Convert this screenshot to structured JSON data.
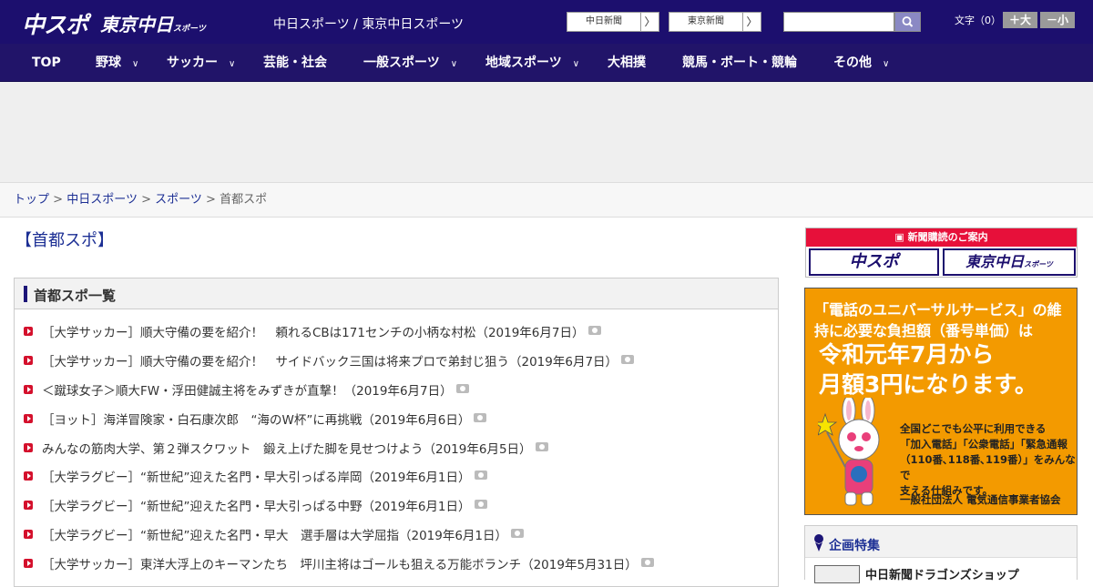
{
  "header": {
    "logo_chuspo": "中スポ",
    "logo_tokyochunichi": "東京中日",
    "logo_tokyochunichi_sub": "スポーツ",
    "site_title": "中日スポーツ / 東京中日スポーツ",
    "link_chunichi": "中日新聞",
    "link_tokyo": "東京新聞",
    "link_arrow": "〉",
    "search_placeholder": "",
    "font_label": "文字（0）",
    "font_larger": "＋大",
    "font_smaller": "－小"
  },
  "nav": {
    "items": [
      {
        "label": "TOP",
        "chevron": false
      },
      {
        "label": "野球",
        "chevron": true
      },
      {
        "label": "サッカー",
        "chevron": true
      },
      {
        "label": "芸能・社会",
        "chevron": false
      },
      {
        "label": "一般スポーツ",
        "chevron": true
      },
      {
        "label": "地域スポーツ",
        "chevron": true
      },
      {
        "label": "大相撲",
        "chevron": false
      },
      {
        "label": "競馬・ボート・競輪",
        "chevron": false
      },
      {
        "label": "その他",
        "chevron": true
      }
    ],
    "chevron_glyph": "∨"
  },
  "breadcrumb": {
    "items": [
      "トップ",
      "中日スポーツ",
      "スポーツ"
    ],
    "current": "首都スポ",
    "separator": ">"
  },
  "page": {
    "title": "【首都スポ】"
  },
  "list": {
    "heading": "首都スポ一覧",
    "items": [
      "［大学サッカー］順大守備の要を紹介！　頼れるCBは171センチの小柄な村松（2019年6月7日）",
      "［大学サッカー］順大守備の要を紹介！　サイドバック三国は将来プロで弟封じ狙う（2019年6月7日）",
      "＜蹴球女子＞順大FW・浮田健誠主将をみずきが直撃！（2019年6月7日）",
      "［ヨット］海洋冒険家・白石康次郎　“海のW杯”に再挑戦（2019年6月6日）",
      "みんなの筋肉大学、第２弾スクワット　鍛え上げた脚を見せつけよう（2019年6月5日）",
      "［大学ラグビー］“新世紀”迎えた名門・早大引っぱる岸岡（2019年6月1日）",
      "［大学ラグビー］“新世紀”迎えた名門・早大引っぱる中野（2019年6月1日）",
      "［大学ラグビー］“新世紀”迎えた名門・早大　選手層は大学屈指（2019年6月1日）",
      "［大学サッカー］東洋大浮上のキーマンたち　坪川主将はゴールも狙える万能ボランチ（2019年5月31日）"
    ]
  },
  "sidebar": {
    "subscribe_heading": "新聞購読のご案内",
    "subscribe_chuspo": "中スポ",
    "subscribe_tokyo": "東京中日",
    "subscribe_tokyo_sub": "スポーツ",
    "ad_line1": "「電話のユニバーサルサービス」の維持に必要な負担額（番号単価）は",
    "ad_line2a": "令和元年7月から",
    "ad_line2b": "月額3円になります。",
    "ad_line3a": "全国どこでも公平に利用できる",
    "ad_line3b": "「加入電話」「公衆電話」「緊急通報",
    "ad_line3c": "（110番､118番､119番）」をみんなで",
    "ad_line3d": "支える仕組みです。",
    "ad_line4": "一般社団法人 電気通信事業者協会",
    "feature_heading": "企画特集",
    "feature_item": "中日新聞ドラゴンズショップ"
  },
  "colors": {
    "header_bg": "#1c0f6e",
    "nav_bg": "#211469",
    "link": "#1c2f94",
    "bullet": "#d4102c",
    "ad_orange": "#f39a00"
  }
}
